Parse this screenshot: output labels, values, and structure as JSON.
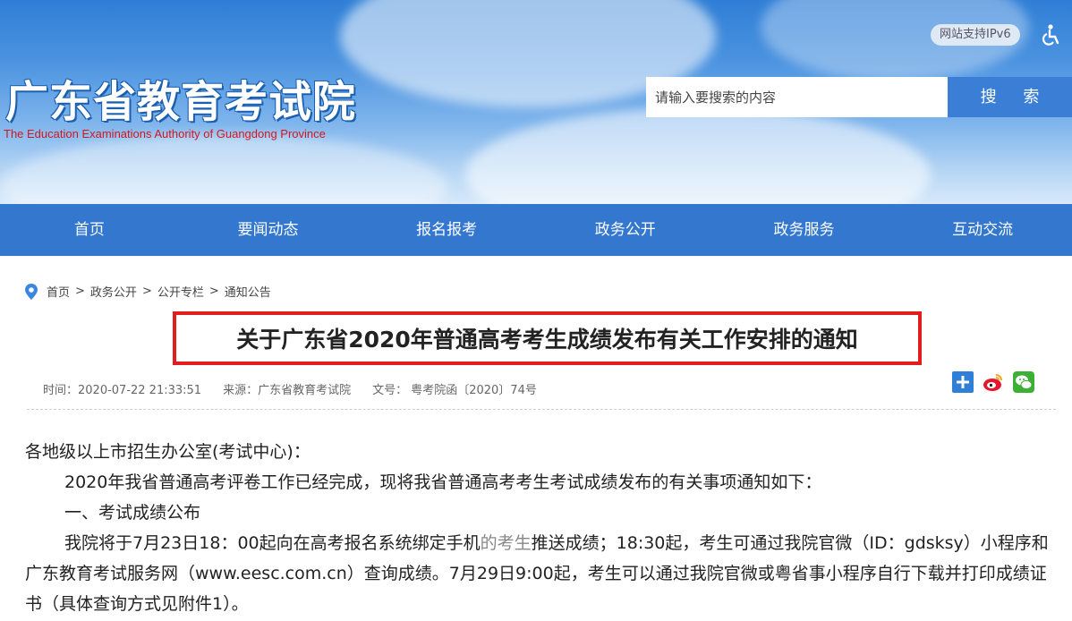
{
  "header": {
    "logo_cn": "广东省教育考试院",
    "logo_en": "The Education Examinations Authority of Guangdong Province",
    "ipv6": "网站支持IPv6",
    "search_placeholder": "请输入要搜索的内容",
    "search_button": "搜 索"
  },
  "nav": [
    "首页",
    "要闻动态",
    "报名报考",
    "政务公开",
    "政务服务",
    "互动交流"
  ],
  "breadcrumb": [
    "首页",
    "政务公开",
    "公开专栏",
    "通知公告"
  ],
  "breadcrumb_sep": ">",
  "article": {
    "title": "关于广东省2020年普通高考考生成绩发布有关工作安排的通知",
    "time": "时间：2020-07-22 21:33:51",
    "source": "来源：广东省教育考试院",
    "doc_no": "文号： 粤考院函〔2020〕74号",
    "salutation": "各地级以上市招生办公室(考试中心)：",
    "para1": "2020年我省普通高考评卷工作已经完成，现将我省普通高考考生考试成绩发布的有关事项通知如下：",
    "section1": "一、考试成绩公布",
    "para2_a": "我院将于7月23日18：00起向在高考报名系统绑定手机",
    "para2_gray": "的考生",
    "para2_b": "推送成绩；18:30起，考生可通过我院官微（ID：gdsksy）小程序和广东教育考试服务网（www.eesc.com.cn）查询成绩。7月29日9:00起，考生可以通过我院官微或粤省事小程序自行下载并打印成绩证书（具体查询方式见附件1）。"
  },
  "colors": {
    "nav": "#3377cf",
    "title_border": "#e01e1e",
    "logo_en": "#d4171e"
  }
}
